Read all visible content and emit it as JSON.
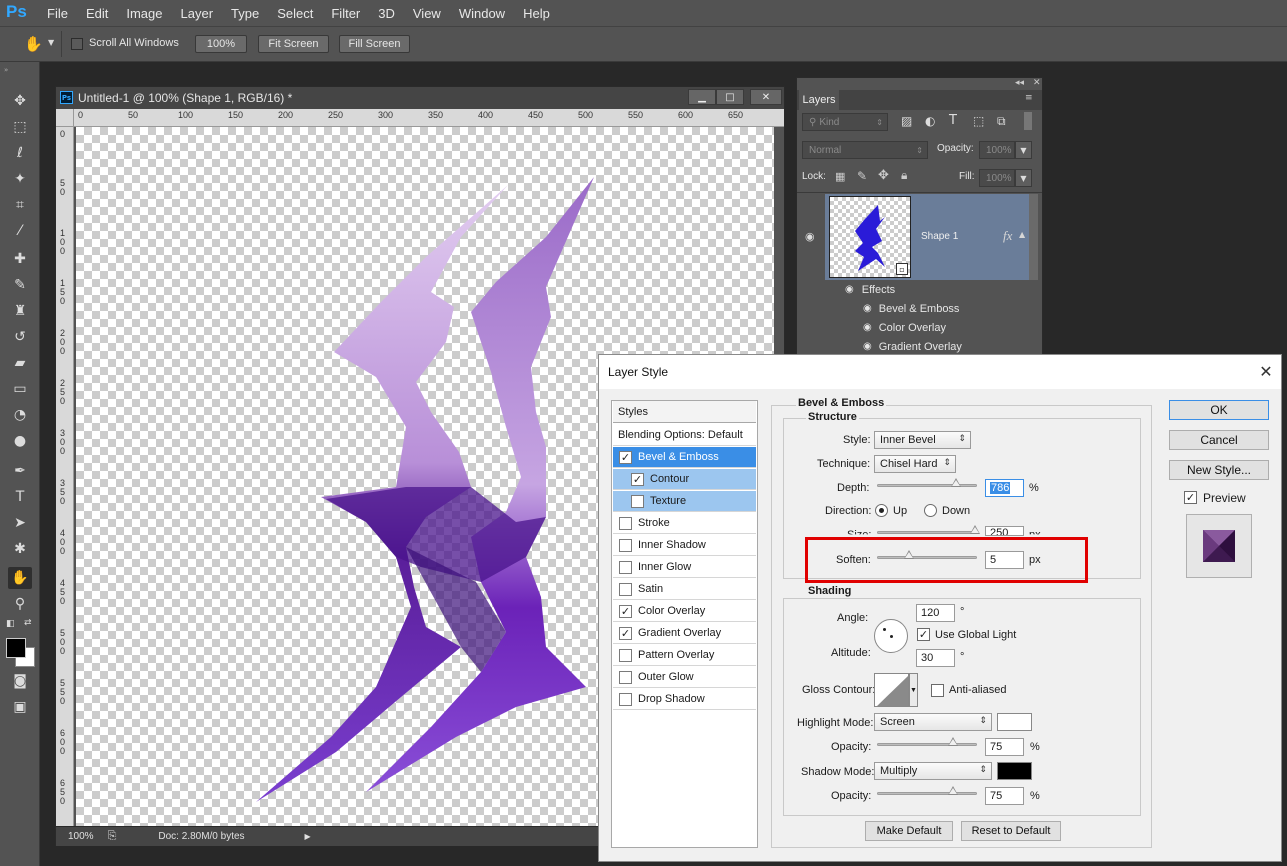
{
  "app": {
    "logo": "Ps",
    "menu": [
      "File",
      "Edit",
      "Image",
      "Layer",
      "Type",
      "Select",
      "Filter",
      "3D",
      "View",
      "Window",
      "Help"
    ]
  },
  "options_bar": {
    "scroll_all_windows": "Scroll All Windows",
    "zoom_100": "100%",
    "fit_screen": "Fit Screen",
    "fill_screen": "Fill Screen"
  },
  "document": {
    "title": "Untitled-1 @ 100% (Shape 1, RGB/16) *",
    "ruler_top": [
      "0",
      "50",
      "100",
      "150",
      "200",
      "250",
      "300",
      "350",
      "400",
      "450",
      "500",
      "550",
      "600",
      "650"
    ],
    "ruler_left": [
      "0",
      "5 0",
      "1 0 0",
      "1 5 0",
      "2 0 0",
      "2 5 0",
      "3 0 0",
      "3 5 0",
      "4 0 0",
      "4 5 0",
      "5 0 0",
      "5 5 0",
      "6 0 0",
      "6 5 0"
    ],
    "status_zoom": "100%",
    "status_doc": "Doc: 2.80M/0 bytes"
  },
  "layers_panel": {
    "tab": "Layers",
    "kind": "Kind",
    "blend_mode": "Normal",
    "opacity_label": "Opacity:",
    "opacity_value": "100%",
    "lock_label": "Lock:",
    "fill_label": "Fill:",
    "fill_value": "100%",
    "layer_name": "Shape 1",
    "fx": "fx",
    "effects_label": "Effects",
    "effects": [
      "Bevel & Emboss",
      "Color Overlay",
      "Gradient Overlay"
    ]
  },
  "dialog": {
    "title": "Layer Style",
    "styles_header": "Styles",
    "blending_options": "Blending Options: Default",
    "styles": [
      {
        "label": "Bevel & Emboss",
        "checked": true,
        "state": "selected",
        "indent": false
      },
      {
        "label": "Contour",
        "checked": true,
        "state": "sub",
        "indent": true
      },
      {
        "label": "Texture",
        "checked": false,
        "state": "sub",
        "indent": true
      },
      {
        "label": "Stroke",
        "checked": false,
        "state": "",
        "indent": false
      },
      {
        "label": "Inner Shadow",
        "checked": false,
        "state": "",
        "indent": false
      },
      {
        "label": "Inner Glow",
        "checked": false,
        "state": "",
        "indent": false
      },
      {
        "label": "Satin",
        "checked": false,
        "state": "",
        "indent": false
      },
      {
        "label": "Color Overlay",
        "checked": true,
        "state": "",
        "indent": false
      },
      {
        "label": "Gradient Overlay",
        "checked": true,
        "state": "",
        "indent": false
      },
      {
        "label": "Pattern Overlay",
        "checked": false,
        "state": "",
        "indent": false
      },
      {
        "label": "Outer Glow",
        "checked": false,
        "state": "",
        "indent": false
      },
      {
        "label": "Drop Shadow",
        "checked": false,
        "state": "",
        "indent": false
      }
    ],
    "section_title": "Bevel & Emboss",
    "structure": {
      "title": "Structure",
      "style_label": "Style:",
      "style_value": "Inner Bevel",
      "technique_label": "Technique:",
      "technique_value": "Chisel Hard",
      "depth_label": "Depth:",
      "depth_value": "786",
      "depth_unit": "%",
      "direction_label": "Direction:",
      "direction_up": "Up",
      "direction_down": "Down",
      "size_label": "Size:",
      "size_value": "250",
      "size_unit": "px",
      "soften_label": "Soften:",
      "soften_value": "5",
      "soften_unit": "px"
    },
    "shading": {
      "title": "Shading",
      "angle_label": "Angle:",
      "angle_value": "120",
      "angle_unit": "°",
      "use_global_light": "Use Global Light",
      "altitude_label": "Altitude:",
      "altitude_value": "30",
      "altitude_unit": "°",
      "gloss_contour_label": "Gloss Contour:",
      "anti_aliased": "Anti-aliased",
      "highlight_mode_label": "Highlight Mode:",
      "highlight_mode_value": "Screen",
      "highlight_color": "#ffffff",
      "highlight_opacity_label": "Opacity:",
      "highlight_opacity_value": "75",
      "shadow_mode_label": "Shadow Mode:",
      "shadow_mode_value": "Multiply",
      "shadow_color": "#000000",
      "shadow_opacity_label": "Opacity:",
      "shadow_opacity_value": "75",
      "percent": "%"
    },
    "make_default": "Make Default",
    "reset_to_default": "Reset to Default",
    "ok": "OK",
    "cancel": "Cancel",
    "new_style": "New Style...",
    "preview": "Preview"
  },
  "colors": {
    "accent_selection": "#3a8ee6",
    "highlight_frame": "#e00000",
    "shape_purple": "#6a2bb0"
  }
}
